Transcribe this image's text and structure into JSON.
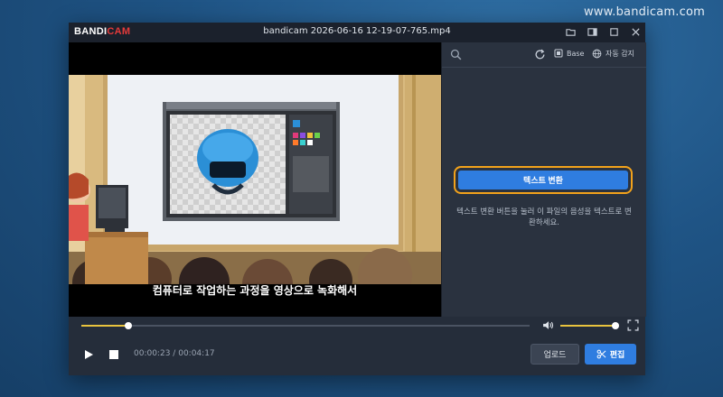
{
  "watermark": "www.bandicam.com",
  "app": {
    "logo_part1": "BANDI",
    "logo_part2": "CAM",
    "file_title": "bandicam 2026-06-16 12-19-07-765.mp4"
  },
  "video": {
    "subtitle": "컴퓨터로 작업하는 과정을 영상으로 녹화해서"
  },
  "panel": {
    "base_label": "Base",
    "language_label": "자동 감지",
    "convert_button": "텍스트 변환",
    "hint": "텍스트 변환 버튼을 눌러 이 파일의 음성을 텍스트로 변환하세요."
  },
  "player": {
    "current_time": "00:00:23",
    "separator": "/",
    "total_time": "00:04:17",
    "progress": 0.104,
    "volume": 0.98
  },
  "actions": {
    "upload": "업로드",
    "edit": "편집"
  },
  "colors": {
    "accent": "#2f7de0",
    "highlight": "#f2a21b",
    "seek": "#e9c33e"
  }
}
